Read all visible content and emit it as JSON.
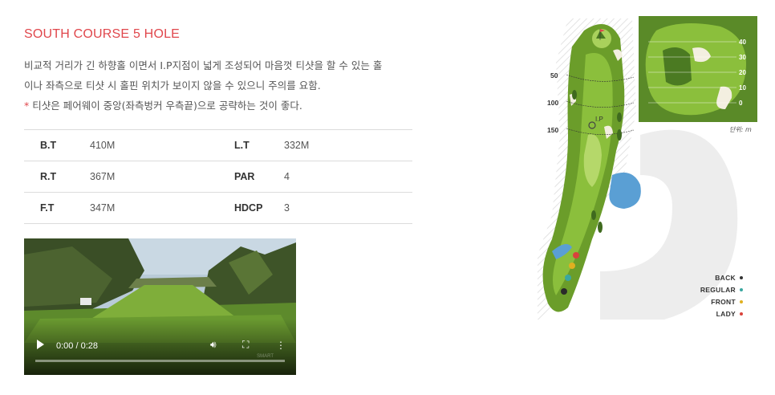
{
  "course": {
    "title": "SOUTH COURSE 5 HOLE",
    "description_line1": "비교적 거리가 긴 하향홀 이면서 I.P지점이 넓게 조성되어 마음껏 티샷을 할 수 있는 홀",
    "description_line2": "이나 좌측으로 티샷 시 홀핀 위치가 보이지 않을 수 있으니 주의를 요함.",
    "note_mark": "*",
    "note_text": " 티샷은 페어웨이 중앙(좌측벙커 우측끝)으로 공략하는 것이 좋다."
  },
  "stats": [
    {
      "k1": "B.T",
      "v1": "410M",
      "k2": "L.T",
      "v2": "332M"
    },
    {
      "k1": "R.T",
      "v1": "367M",
      "k2": "PAR",
      "v2": "4"
    },
    {
      "k1": "F.T",
      "v1": "347M",
      "k2": "HDCP",
      "v2": "3"
    }
  ],
  "video": {
    "time": "0:00 / 0:28",
    "progress": 0,
    "watermark": "SMART"
  },
  "map": {
    "hole_number": "5",
    "distance_marks": [
      "50",
      "100",
      "150"
    ],
    "ip_label": "I.P",
    "green_scale": [
      "40",
      "30",
      "20",
      "10",
      "0"
    ],
    "unit": "단위: m",
    "colors": {
      "fairway": "#8bbf3c",
      "rough": "#6b9d2a",
      "water": "#5a9fd4",
      "bunker": "#f3efe0"
    }
  },
  "legend": [
    {
      "label": "BACK",
      "color": "#333333"
    },
    {
      "label": "REGULAR",
      "color": "#3aa7a0"
    },
    {
      "label": "FRONT",
      "color": "#e0b020"
    },
    {
      "label": "LADY",
      "color": "#d9433c"
    }
  ]
}
